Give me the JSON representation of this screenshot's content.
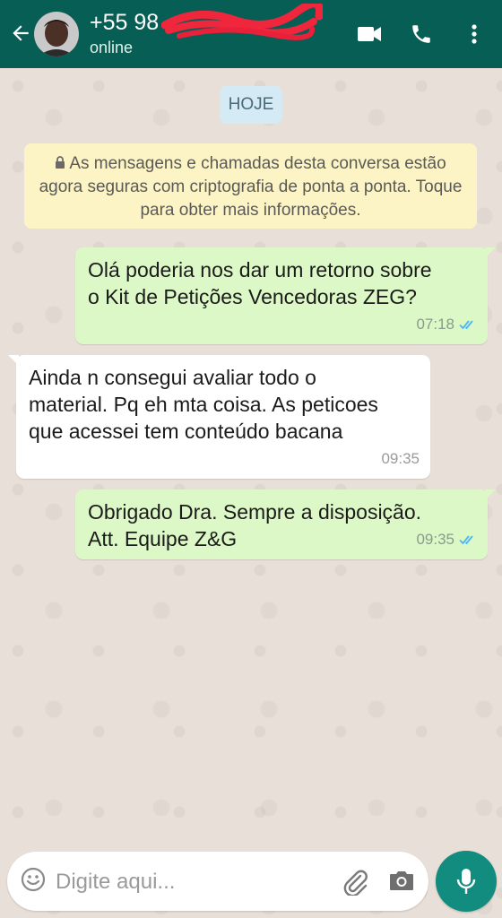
{
  "header": {
    "contact_name": "+55 98",
    "status": "online",
    "back_icon": "arrow-left-icon",
    "video_icon": "video-camera-icon",
    "call_icon": "phone-icon",
    "menu_icon": "more-vertical-icon",
    "background_color": "#075e54"
  },
  "chat": {
    "date_label": "HOJE",
    "encryption_notice": "As mensagens e chamadas desta conversa estão agora seguras com criptografia de ponta a ponta. Toque para obter mais informações.",
    "messages": [
      {
        "direction": "outgoing",
        "text": "Olá poderia nos dar um retorno sobre\no Kit de Petições Vencedoras ZEG?",
        "time": "07:18",
        "status": "read"
      },
      {
        "direction": "incoming",
        "text": "Ainda n consegui avaliar todo o\nmaterial. Pq eh mta coisa. As peticoes\nque acessei tem conteúdo bacana",
        "time": "09:35"
      },
      {
        "direction": "outgoing",
        "text": "Obrigado Dra. Sempre a disposição.\nAtt. Equipe Z&G",
        "time": "09:35",
        "status": "read"
      }
    ],
    "outgoing_color": "#dcf8c6",
    "incoming_color": "#ffffff",
    "read_tick_color": "#4fb6ec"
  },
  "composer": {
    "placeholder": "Digite aqui...",
    "emoji_icon": "emoji-icon",
    "attach_icon": "paperclip-icon",
    "camera_icon": "camera-icon",
    "mic_icon": "microphone-icon",
    "mic_button_color": "#128c7e"
  }
}
